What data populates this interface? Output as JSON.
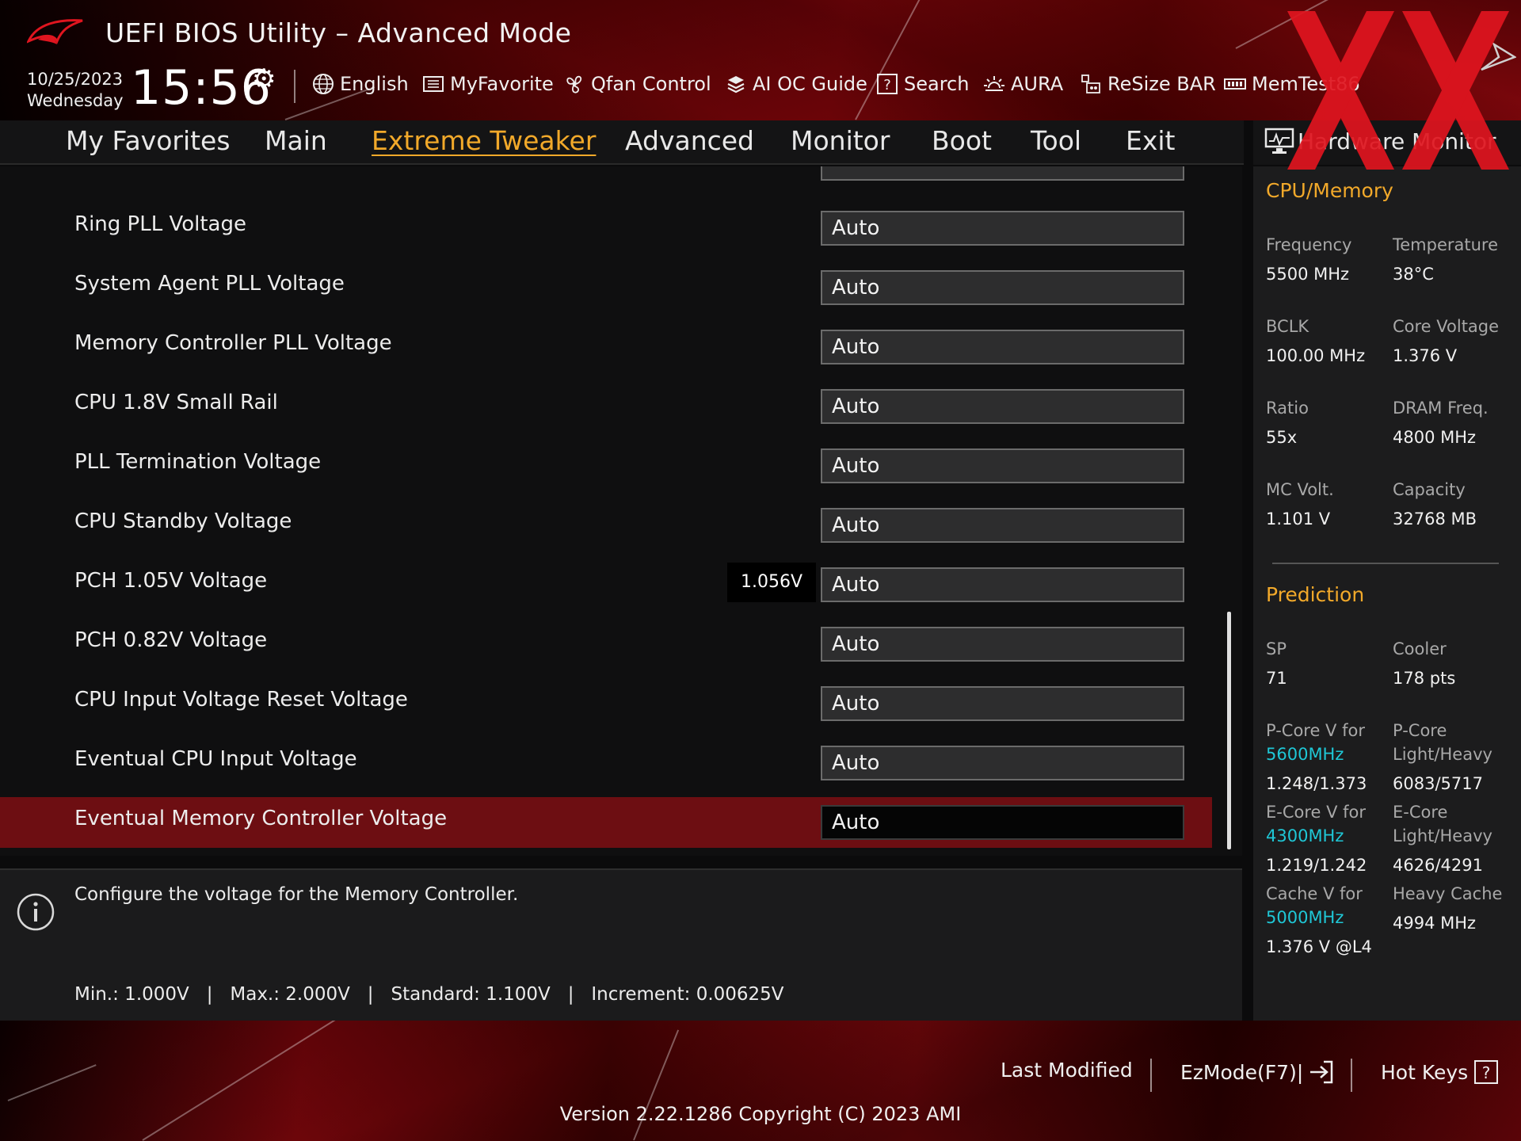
{
  "header": {
    "title": "UEFI BIOS Utility – Advanced Mode",
    "date": "10/25/2023",
    "day": "Wednesday",
    "time": "15:56",
    "tools": [
      {
        "label": "English",
        "icon": "globe-icon"
      },
      {
        "label": "MyFavorite",
        "icon": "myfavorite-icon"
      },
      {
        "label": "Qfan Control",
        "icon": "fan-icon"
      },
      {
        "label": "AI OC Guide",
        "icon": "ai-oc-guide-icon"
      },
      {
        "label": "Search",
        "icon": "search-help-icon"
      },
      {
        "label": "AURA",
        "icon": "aura-icon"
      },
      {
        "label": "ReSize BAR",
        "icon": "resize-bar-icon"
      },
      {
        "label": "MemTest86",
        "icon": "memtest-icon"
      }
    ]
  },
  "tabs": [
    {
      "label": "My Favorites"
    },
    {
      "label": "Main"
    },
    {
      "label": "Extreme Tweaker",
      "active": true
    },
    {
      "label": "Advanced"
    },
    {
      "label": "Monitor"
    },
    {
      "label": "Boot"
    },
    {
      "label": "Tool"
    },
    {
      "label": "Exit"
    }
  ],
  "settings": [
    {
      "label": "Ring PLL Voltage",
      "value": "Auto"
    },
    {
      "label": "System Agent PLL Voltage",
      "value": "Auto"
    },
    {
      "label": "Memory Controller PLL Voltage",
      "value": "Auto"
    },
    {
      "label": "CPU 1.8V Small Rail",
      "value": "Auto"
    },
    {
      "label": "PLL Termination Voltage",
      "value": "Auto"
    },
    {
      "label": "CPU Standby Voltage",
      "value": "Auto"
    },
    {
      "label": "PCH 1.05V Voltage",
      "value": "Auto",
      "readout": "1.056V"
    },
    {
      "label": "PCH 0.82V Voltage",
      "value": "Auto"
    },
    {
      "label": "CPU Input Voltage Reset Voltage",
      "value": "Auto"
    },
    {
      "label": "Eventual CPU Input Voltage",
      "value": "Auto"
    },
    {
      "label": "Eventual Memory Controller Voltage",
      "value": "Auto",
      "selected": true
    }
  ],
  "help": {
    "text": "Configure the voltage for the Memory Controller.",
    "range": "Min.: 1.000V   |   Max.: 2.000V   |   Standard: 1.100V   |   Increment: 0.00625V"
  },
  "hwmon": {
    "title": "Hardware Monitor",
    "cpu_memory": {
      "heading": "CPU/Memory",
      "items": [
        {
          "label": "Frequency",
          "value": "5500 MHz"
        },
        {
          "label": "Temperature",
          "value": "38°C"
        },
        {
          "label": "BCLK",
          "value": "100.00 MHz"
        },
        {
          "label": "Core Voltage",
          "value": "1.376 V"
        },
        {
          "label": "Ratio",
          "value": "55x"
        },
        {
          "label": "DRAM Freq.",
          "value": "4800 MHz"
        },
        {
          "label": "MC Volt.",
          "value": "1.101 V"
        },
        {
          "label": "Capacity",
          "value": "32768 MB"
        }
      ]
    },
    "prediction": {
      "heading": "Prediction",
      "sp_label": "SP",
      "sp_value": "71",
      "cooler_label": "Cooler",
      "cooler_value": "178 pts",
      "pcore_v_label": "P-Core V for",
      "pcore_v_freq": "5600MHz",
      "pcore_v_value": "1.248/1.373",
      "pcore_lh_label1": "P-Core",
      "pcore_lh_label2": "Light/Heavy",
      "pcore_lh_value": "6083/5717",
      "ecore_v_label": "E-Core V for",
      "ecore_v_freq": "4300MHz",
      "ecore_v_value": "1.219/1.242",
      "ecore_lh_label1": "E-Core",
      "ecore_lh_label2": "Light/Heavy",
      "ecore_lh_value": "4626/4291",
      "cache_v_label": "Cache V for",
      "cache_v_freq": "5000MHz",
      "cache_v_value": "1.376 V @L4",
      "heavy_cache_label": "Heavy Cache",
      "heavy_cache_value": "4994 MHz"
    }
  },
  "footer": {
    "last_modified": "Last Modified",
    "ezmode": "EzMode(F7)|",
    "hotkeys": "Hot Keys",
    "version": "Version 2.22.1286 Copyright (C) 2023 AMI"
  },
  "colors": {
    "accent": "#f2a92a",
    "selected_row": "#6d0e12",
    "frequency_highlight": "#1fc7d6",
    "brand_red": "#8a0a10"
  }
}
